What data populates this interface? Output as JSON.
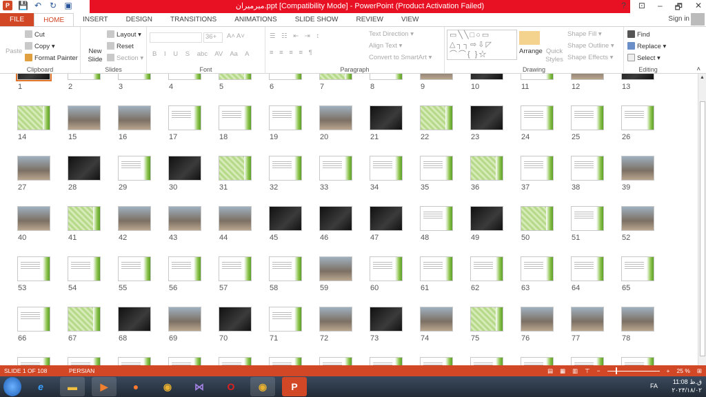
{
  "window": {
    "title": "میرمیران.ppt [Compatibility Mode] -  PowerPoint (Product Activation Failed)",
    "help": "?",
    "min": "–",
    "max": "🗗",
    "close": "✕"
  },
  "tabs": [
    "FILE",
    "HOME",
    "INSERT",
    "DESIGN",
    "TRANSITIONS",
    "ANIMATIONS",
    "SLIDE SHOW",
    "REVIEW",
    "VIEW"
  ],
  "active_tab": "HOME",
  "sign_in": "Sign in",
  "ribbon": {
    "clipboard": {
      "label": "Clipboard",
      "paste": "Paste",
      "cut": "Cut",
      "copy": "Copy",
      "format_painter": "Format Painter"
    },
    "slides": {
      "label": "Slides",
      "new_slide": "New Slide",
      "layout": "Layout",
      "reset": "Reset",
      "section": "Section"
    },
    "font": {
      "label": "Font",
      "font_size": "36+",
      "buttons": [
        "B",
        "I",
        "U",
        "S",
        "abc",
        "AV",
        "Aa",
        "A"
      ]
    },
    "paragraph": {
      "label": "Paragraph",
      "text_direction": "Text Direction",
      "align_text": "Align Text",
      "convert": "Convert to SmartArt"
    },
    "drawing": {
      "label": "Drawing",
      "arrange": "Arrange",
      "quick_styles": "Quick Styles",
      "shape_fill": "Shape Fill",
      "shape_outline": "Shape Outline",
      "shape_effects": "Shape Effects"
    },
    "editing": {
      "label": "Editing",
      "find": "Find",
      "replace": "Replace",
      "select": "Select"
    }
  },
  "slides": [
    "dark",
    "white",
    "white",
    "white",
    "green",
    "white",
    "green",
    "white",
    "photo",
    "dark",
    "white",
    "photo",
    "dark",
    "green",
    "photo",
    "photo",
    "white",
    "white",
    "white",
    "photo",
    "dark",
    "green",
    "dark",
    "white",
    "white",
    "white",
    "photo",
    "dark",
    "white",
    "dark",
    "green",
    "white",
    "white",
    "white",
    "white",
    "green",
    "white",
    "white",
    "photo",
    "photo",
    "green",
    "photo",
    "photo",
    "photo",
    "dark",
    "dark",
    "dark",
    "white",
    "dark",
    "green",
    "white",
    "photo",
    "white",
    "white",
    "white",
    "white",
    "white",
    "white",
    "photo",
    "white",
    "white",
    "white",
    "white",
    "white",
    "white",
    "white",
    "green",
    "dark",
    "photo",
    "dark",
    "white",
    "photo",
    "dark",
    "photo",
    "green",
    "photo",
    "photo",
    "photo",
    "white",
    "white",
    "white",
    "white",
    "white",
    "white",
    "white",
    "white",
    "white",
    "white",
    "white",
    "white",
    "white"
  ],
  "selected_slide": 1,
  "status": {
    "slide": "SLIDE 1 OF 108",
    "language": "PERSIAN",
    "zoom": "25 %",
    "zoom_percent": 25
  },
  "taskbar": {
    "lang": "FA",
    "time": "11:08 ق.ظ",
    "date": "۲۰۲۴/۱۸/۰۲"
  }
}
